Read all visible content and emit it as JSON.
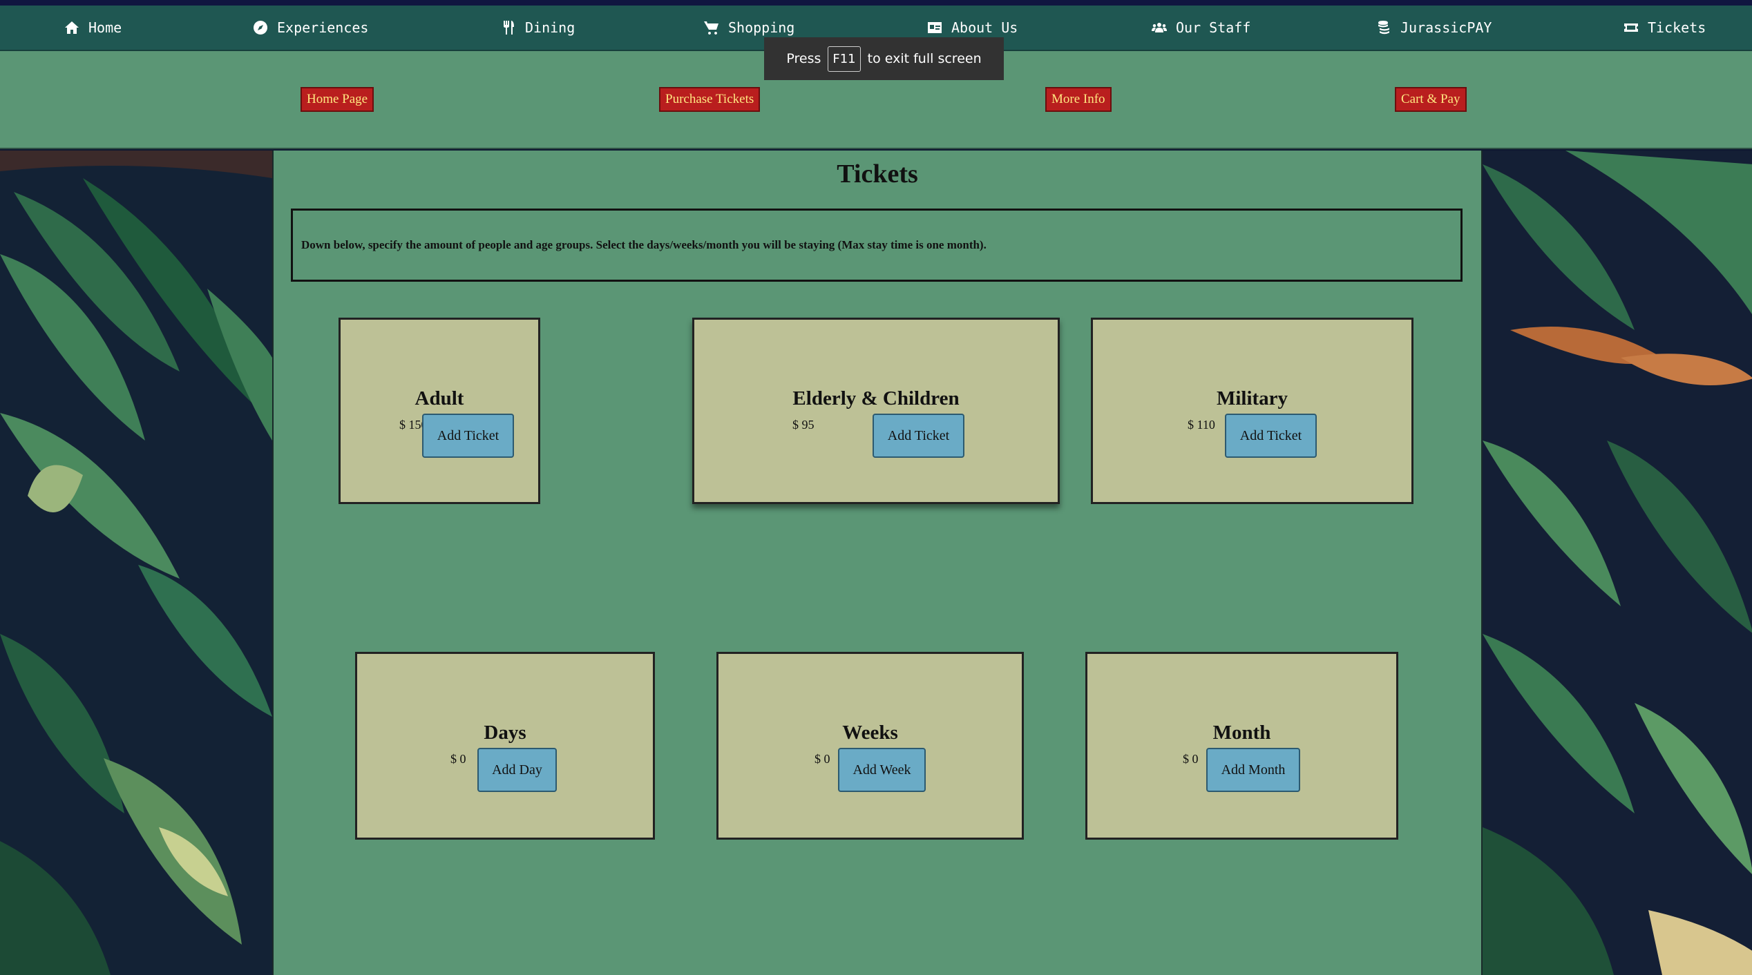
{
  "nav": {
    "items": [
      {
        "label": "Home",
        "icon": "home-icon"
      },
      {
        "label": "Experiences",
        "icon": "compass-icon"
      },
      {
        "label": "Dining",
        "icon": "utensils-icon"
      },
      {
        "label": "Shopping",
        "icon": "cart-icon"
      },
      {
        "label": "About Us",
        "icon": "id-card-icon"
      },
      {
        "label": "Our Staff",
        "icon": "users-icon"
      },
      {
        "label": "JurassicPAY",
        "icon": "coins-icon"
      },
      {
        "label": "Tickets",
        "icon": "ticket-icon"
      }
    ]
  },
  "subnav": {
    "home": "Home Page",
    "purchase": "Purchase Tickets",
    "info": "More Info",
    "cart": "Cart & Pay"
  },
  "toast": {
    "before": "Press",
    "key": "F11",
    "after": "to exit full screen"
  },
  "page": {
    "title": "Tickets",
    "description": "Down below, specify the amount of people and age groups. Select the days/weeks/month you will be staying (Max stay time is one month)."
  },
  "cards": [
    {
      "title": "Adult",
      "price": "$ 150",
      "button": "Add Ticket"
    },
    {
      "title": "Elderly & Children",
      "price": "$ 95",
      "button": "Add Ticket"
    },
    {
      "title": "Military",
      "price": "$ 110",
      "button": "Add Ticket"
    },
    {
      "title": "Days",
      "price": "$ 0",
      "button": "Add Day"
    },
    {
      "title": "Weeks",
      "price": "$ 0",
      "button": "Add Week"
    },
    {
      "title": "Month",
      "price": "$ 0",
      "button": "Add Month"
    }
  ],
  "colors": {
    "navbar": "#1f5752",
    "subbar": "#5b9675",
    "subnav_button": "#b91e1e",
    "subnav_text": "#ffe680",
    "card": "#bdc196",
    "add_button": "#6aabc6"
  }
}
